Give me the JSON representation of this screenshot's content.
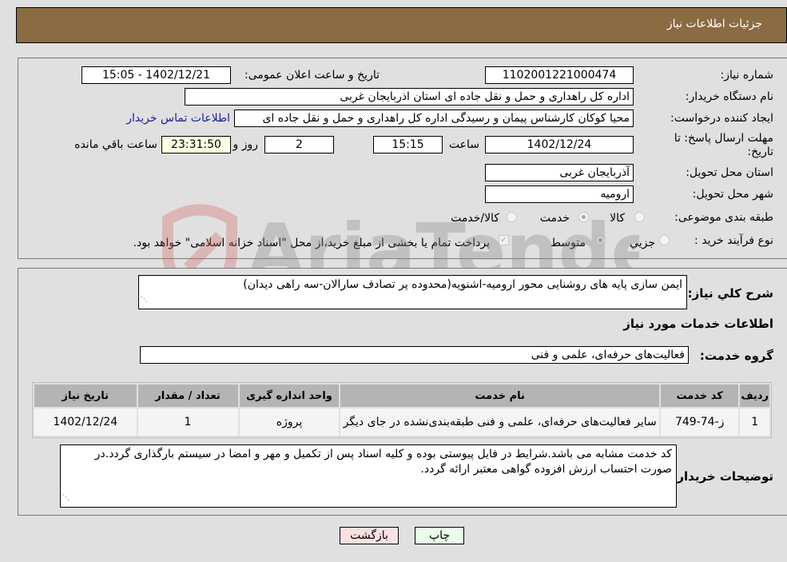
{
  "header": {
    "title": "جزئیات اطلاعات نیاز"
  },
  "info": {
    "need_number_label": "شماره نیاز:",
    "need_number": "1102001221000474",
    "announce_label": "تاریخ و ساعت اعلان عمومی:",
    "announce_value": "1402/12/21 - 15:05",
    "buyer_org_label": "نام دستگاه خریدار:",
    "buyer_org": "اداره کل راهداری و حمل و نقل جاده ای استان اذربایجان غربی",
    "creator_label": "ایجاد کننده درخواست:",
    "creator": "محیا کوکان کارشناس پیمان و رسیدگی اداره کل راهداری و حمل و نقل جاده ای",
    "contact_link": "اطلاعات تماس خریدار",
    "deadline_label": "مهلت ارسال پاسخ: تا تاریخ:",
    "deadline_date": "1402/12/24",
    "time_label": "ساعت",
    "deadline_time": "15:15",
    "days_value": "2",
    "days_label": "روز و",
    "remaining_time": "23:31:50",
    "remaining_label": "ساعت باقي مانده",
    "province_label": "استان محل تحویل:",
    "province": "آذربایجان غربی",
    "city_label": "شهر محل تحویل:",
    "city": "ارومیه",
    "category_label": "طبقه بندی موضوعی:",
    "category_options": [
      {
        "label": "کالا",
        "checked": false
      },
      {
        "label": "خدمت",
        "checked": true
      },
      {
        "label": "کالا/خدمت",
        "checked": false
      }
    ],
    "process_label": "نوع فرآیند خرید :",
    "process_options": [
      {
        "label": "جزیي",
        "checked": false
      },
      {
        "label": "متوسط",
        "checked": true
      }
    ],
    "treasury_checked": true,
    "treasury_text": "پرداخت تمام یا بخشی از مبلغ خرید،از محل \"اسناد خزانه اسلامی\" خواهد بود."
  },
  "description": {
    "label": "شرح كلي نياز:",
    "value": "ایمن سازی پایه های روشنایی محور ارومیه-اشنویه(محدوده پر تصادف سارالان-سه راهی دیدان)"
  },
  "services": {
    "section_title": "اطلاعات خدمات مورد نیاز",
    "group_label": "گروه خدمت:",
    "group_value": "فعالیت‌های حرفه‌ای، علمی و فنی",
    "columns": [
      "ردیف",
      "کد خدمت",
      "نام خدمت",
      "واحد اندازه گیری",
      "تعداد / مقدار",
      "تاریخ نیاز"
    ],
    "rows": [
      {
        "index": "1",
        "code": "ز-74-749",
        "name": "سایر فعالیت‌های حرفه‌ای، علمی و فنی طبقه‌بندی‌نشده در جای دیگر",
        "unit": "پروژه",
        "quantity": "1",
        "date": "1402/12/24"
      }
    ]
  },
  "buyer_notes": {
    "label": "توضیحات خریدار:",
    "value": "کد خدمت مشابه می باشد.شرایط در فایل پیوستی بوده و کلیه اسناد پس از تکمیل و مهر و امضا در سیستم بارگذاری گردد.در صورت احتساب ارزش افزوده گواهی معتبر ارائه گردد."
  },
  "buttons": {
    "print": "چاپ",
    "back": "بازگشت"
  },
  "watermark": {
    "text": "AriaTender.neT"
  }
}
